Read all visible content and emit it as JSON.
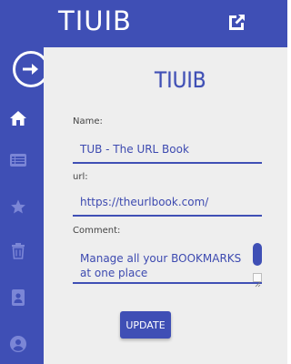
{
  "header": {
    "title": "TIUIB",
    "external_icon": "external-link-icon"
  },
  "sidebar": {
    "toggle_icon": "arrow-right-icon",
    "items": [
      {
        "name": "home",
        "icon": "home-icon",
        "active": true
      },
      {
        "name": "list",
        "icon": "list-icon",
        "active": false
      },
      {
        "name": "favorites",
        "icon": "star-icon",
        "active": false
      },
      {
        "name": "trash",
        "icon": "trash-icon",
        "active": false
      },
      {
        "name": "contacts",
        "icon": "contact-icon",
        "active": false
      },
      {
        "name": "account",
        "icon": "account-icon",
        "active": false
      }
    ]
  },
  "logo": "TIUIB",
  "form": {
    "name_label": "Name:",
    "name_value": "TUB - The URL Book",
    "url_label": "url:",
    "url_value": "https://theurlbook.com/",
    "comment_label": "Comment:",
    "comment_value": "Manage all your BOOKMARKS at one place",
    "update_label": "UPDATE"
  },
  "colors": {
    "primary": "#3f4fb5",
    "content_bg": "#eeeeee",
    "inactive_icon": "#7b86d6"
  }
}
